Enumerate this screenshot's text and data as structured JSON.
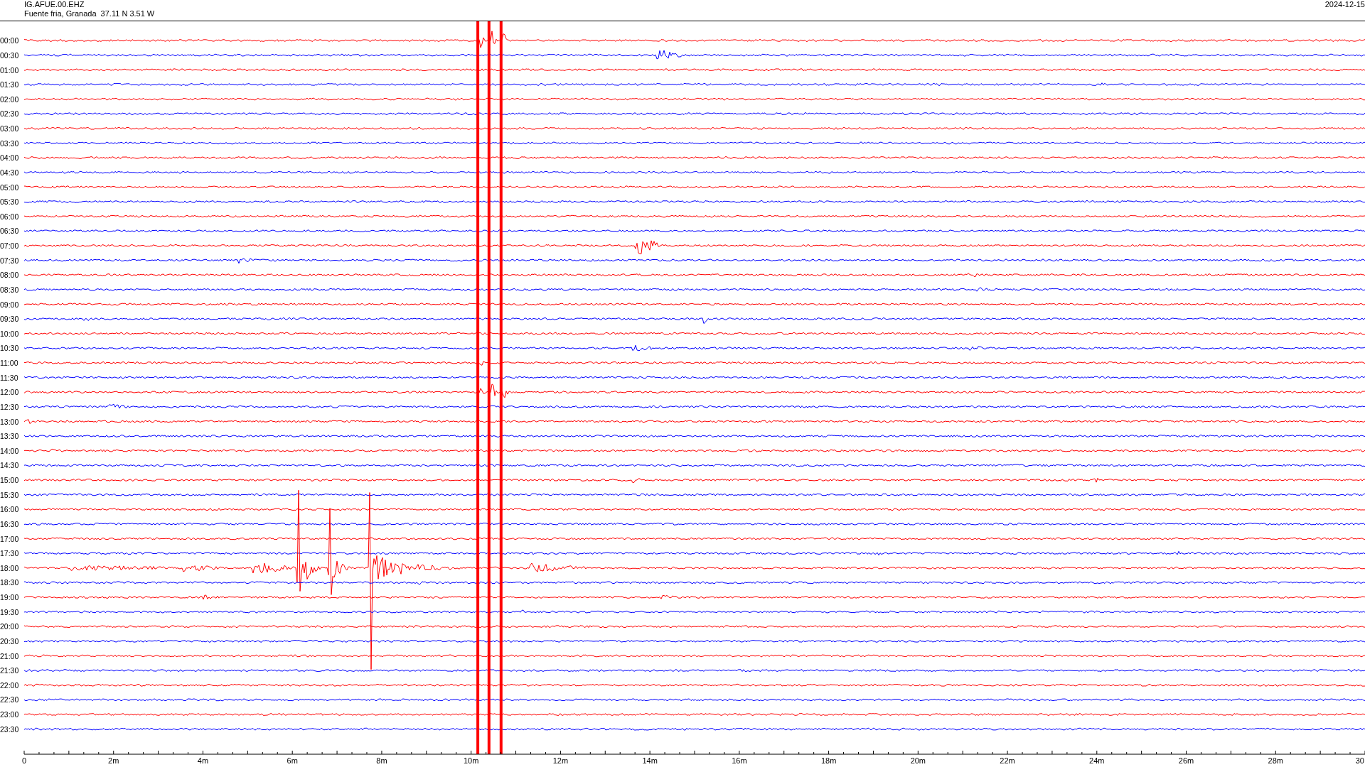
{
  "header": {
    "station": "IG.AFUE.00.EHZ",
    "location": "Fuente fria, Granada  37.11 N 3.51 W",
    "date": "2024-12-15"
  },
  "rows": [
    {
      "label": "00:00",
      "color": "#ff0000"
    },
    {
      "label": "00:30",
      "color": "#0000ff"
    },
    {
      "label": "01:00",
      "color": "#ff0000"
    },
    {
      "label": "01:30",
      "color": "#0000ff"
    },
    {
      "label": "02:00",
      "color": "#ff0000"
    },
    {
      "label": "02:30",
      "color": "#0000ff"
    },
    {
      "label": "03:00",
      "color": "#ff0000"
    },
    {
      "label": "03:30",
      "color": "#0000ff"
    },
    {
      "label": "04:00",
      "color": "#ff0000"
    },
    {
      "label": "04:30",
      "color": "#0000ff"
    },
    {
      "label": "05:00",
      "color": "#ff0000"
    },
    {
      "label": "05:30",
      "color": "#0000ff"
    },
    {
      "label": "06:00",
      "color": "#ff0000"
    },
    {
      "label": "06:30",
      "color": "#0000ff"
    },
    {
      "label": "07:00",
      "color": "#ff0000"
    },
    {
      "label": "07:30",
      "color": "#0000ff"
    },
    {
      "label": "08:00",
      "color": "#ff0000"
    },
    {
      "label": "08:30",
      "color": "#0000ff"
    },
    {
      "label": "09:00",
      "color": "#ff0000"
    },
    {
      "label": "09:30",
      "color": "#0000ff"
    },
    {
      "label": "10:00",
      "color": "#ff0000"
    },
    {
      "label": "10:30",
      "color": "#0000ff"
    },
    {
      "label": "11:00",
      "color": "#ff0000"
    },
    {
      "label": "11:30",
      "color": "#0000ff"
    },
    {
      "label": "12:00",
      "color": "#ff0000"
    },
    {
      "label": "12:30",
      "color": "#0000ff"
    },
    {
      "label": "13:00",
      "color": "#ff0000"
    },
    {
      "label": "13:30",
      "color": "#0000ff"
    },
    {
      "label": "14:00",
      "color": "#ff0000"
    },
    {
      "label": "14:30",
      "color": "#0000ff"
    },
    {
      "label": "15:00",
      "color": "#ff0000"
    },
    {
      "label": "15:30",
      "color": "#0000ff"
    },
    {
      "label": "16:00",
      "color": "#ff0000"
    },
    {
      "label": "16:30",
      "color": "#0000ff"
    },
    {
      "label": "17:00",
      "color": "#ff0000"
    },
    {
      "label": "17:30",
      "color": "#0000ff"
    },
    {
      "label": "18:00",
      "color": "#ff0000"
    },
    {
      "label": "18:30",
      "color": "#0000ff"
    },
    {
      "label": "19:00",
      "color": "#ff0000"
    },
    {
      "label": "19:30",
      "color": "#0000ff"
    },
    {
      "label": "20:00",
      "color": "#ff0000"
    },
    {
      "label": "20:30",
      "color": "#0000ff"
    },
    {
      "label": "21:00",
      "color": "#ff0000"
    },
    {
      "label": "21:30",
      "color": "#0000ff"
    },
    {
      "label": "22:00",
      "color": "#ff0000"
    },
    {
      "label": "22:30",
      "color": "#0000ff"
    },
    {
      "label": "23:00",
      "color": "#ff0000"
    },
    {
      "label": "23:30",
      "color": "#0000ff"
    }
  ],
  "x_axis": {
    "labels": [
      "0",
      "2m",
      "4m",
      "6m",
      "8m",
      "10m",
      "12m",
      "14m",
      "16m",
      "18m",
      "20m",
      "22m",
      "24m",
      "26m",
      "28m",
      "30"
    ]
  }
}
